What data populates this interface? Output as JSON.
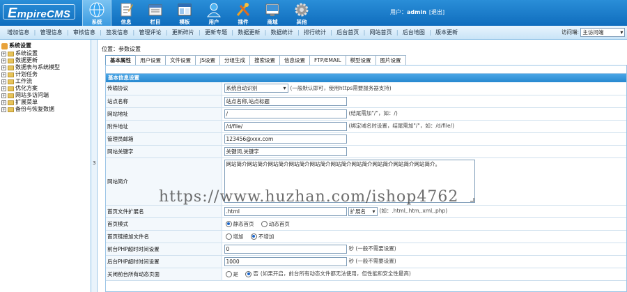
{
  "logo": {
    "text_big": "E",
    "text_rest": "mpireCMS"
  },
  "topnav": [
    {
      "label": "系统",
      "icon": "globe-icon",
      "active": true
    },
    {
      "label": "信息",
      "icon": "document-icon"
    },
    {
      "label": "栏目",
      "icon": "folder-icon"
    },
    {
      "label": "模板",
      "icon": "template-icon"
    },
    {
      "label": "用户",
      "icon": "user-icon"
    },
    {
      "label": "插件",
      "icon": "tools-icon"
    },
    {
      "label": "商城",
      "icon": "shop-icon"
    },
    {
      "label": "其他",
      "icon": "gear-icon"
    }
  ],
  "user": {
    "prefix": "用户：",
    "name": "admin",
    "logout": "[退出]"
  },
  "subnav": [
    "增加信息",
    "管理信息",
    "审核信息",
    "签发信息",
    "管理评论",
    "更新碎片",
    "更新专题",
    "数据更新",
    "数据统计",
    "排行统计",
    "后台首页",
    "网站首页",
    "后台地图",
    "版本更新"
  ],
  "visit": {
    "label": "访问端:",
    "value": "主访问端"
  },
  "tree": {
    "root": "系统设置",
    "items": [
      "系统设置",
      "数据更新",
      "数据表与系统模型",
      "计划任务",
      "工作流",
      "优化方案",
      "网站多访问端",
      "扩展菜单",
      "备份与恢复数据"
    ]
  },
  "splitter_glyph": "3",
  "breadcrumb": {
    "prefix": "位置：",
    "current": "参数设置"
  },
  "tabs": [
    "基本属性",
    "用户设置",
    "文件设置",
    "JS设置",
    "分组生成",
    "搜索设置",
    "信息设置",
    "FTP/EMAIL",
    "模型设置",
    "图片设置"
  ],
  "section_title": "基本信息设置",
  "form": {
    "protocol": {
      "label": "传输协议",
      "value": "系统自动识别",
      "hint": "(一般默认即可，使用https需要服务器支持)"
    },
    "site_name": {
      "label": "站点名称",
      "value": "站点名称,站点标题"
    },
    "site_url": {
      "label": "网站地址",
      "value": "/",
      "hint": "(结尾需加\"/\"，如：/)"
    },
    "attach_url": {
      "label": "附件地址",
      "value": "/d/file/",
      "hint": "(绑定域名时设置，结尾需加\"/\"，如：/d/file/)"
    },
    "admin_email": {
      "label": "管理员邮箱",
      "value": "123456@xxx.com"
    },
    "keywords": {
      "label": "网站关键字",
      "value": "关键词,关键字"
    },
    "intro": {
      "label": "网站简介",
      "value": "网站简介网站简介网站简介网站简介网站简介网站简介网站简介网站简介网站简介网站简介。"
    },
    "index_ext": {
      "label": "首页文件扩展名",
      "value": ".html",
      "select": "扩展名",
      "hint": "(如：.html,.htm,.xml,.php)"
    },
    "index_mode": {
      "label": "首页模式",
      "opt1": "静态首页",
      "opt2": "动态首页"
    },
    "index_link": {
      "label": "首页链接加文件名",
      "opt1": "增加",
      "opt2": "不增加"
    },
    "front_timeout": {
      "label": "前台PHP超时时间设置",
      "value": "0",
      "hint": "秒 (一般不需要设置)"
    },
    "back_timeout": {
      "label": "后台PHP超时时间设置",
      "value": "1000",
      "hint": "秒 (一般不需要设置)"
    },
    "close_dynamic": {
      "label": "关闭前台所有动态页面",
      "opt1": "是",
      "opt2": "否",
      "hint": "(如果开启，前台所有动态文件都无法使用，但性能和安全性最高)"
    }
  },
  "watermark": "https://www.huzhan.com/ishop4762"
}
